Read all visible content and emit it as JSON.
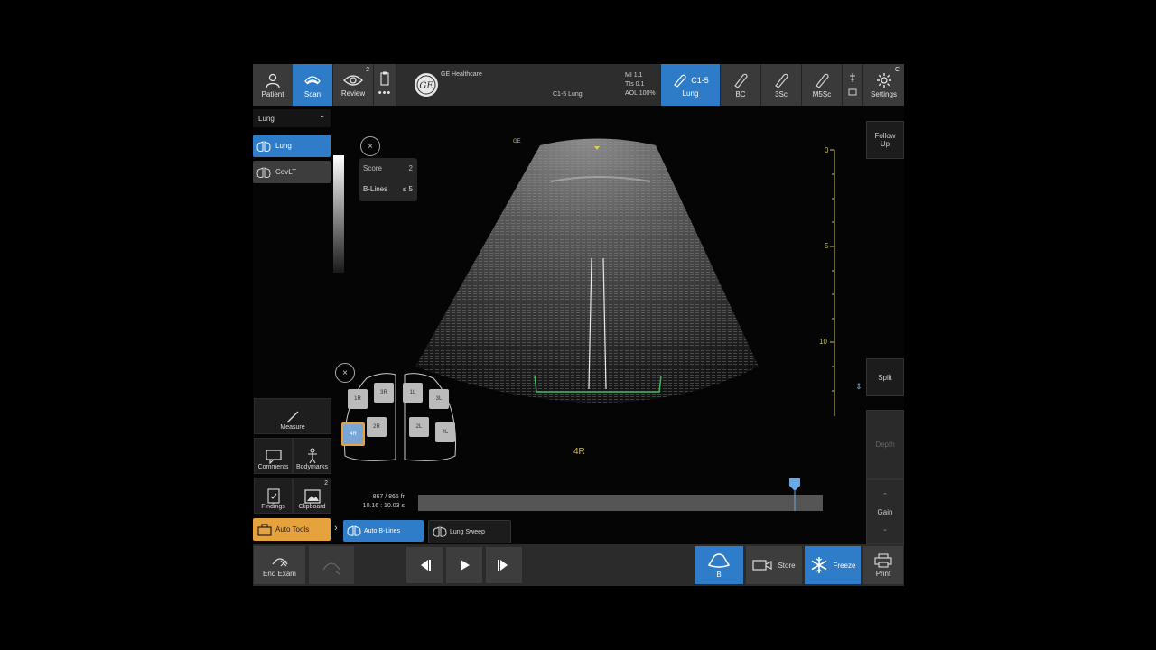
{
  "toolbar": {
    "patient": "Patient",
    "scan": "Scan",
    "review": "Review",
    "review_badge": "2",
    "more": "•••",
    "brand": "GE Healthcare",
    "probe_preset": "C1-5  Lung",
    "mi": "MI 1.1",
    "tis": "TIs 0.1",
    "aol": "AOL 100%",
    "probes": [
      {
        "title": "C1-5",
        "sub": "Lung"
      },
      {
        "title": "",
        "sub": "BC"
      },
      {
        "title": "",
        "sub": "3Sc"
      },
      {
        "title": "",
        "sub": "M5Sc"
      }
    ],
    "settings": "Settings",
    "settings_badge": "C"
  },
  "left": {
    "preset_header": "Lung",
    "presets": [
      "Lung",
      "CovLT"
    ],
    "measure": "Measure",
    "comments": "Comments",
    "bodymarks": "Bodymarks",
    "findings": "Findings",
    "clipboard": "Clipboard",
    "clipboard_badge": "2",
    "auto_tools": "Auto Tools"
  },
  "overlay": {
    "score_label": "Score",
    "score_value": "2",
    "blines_label": "B-Lines",
    "blines_value": "≤ 5",
    "zone_label": "4R",
    "focus_label": "GE",
    "lung_zones_left": [
      "1R",
      "3R",
      "2R",
      "4R"
    ],
    "lung_zones_right": [
      "1L",
      "3L",
      "2L",
      "4L"
    ]
  },
  "depth_scale": {
    "ticks": [
      "0",
      "5",
      "10"
    ]
  },
  "cine": {
    "frames": "867 / 865 fr",
    "time": "10.16 : 10.03 s",
    "position": 0.93
  },
  "auto_tabs": [
    "Auto B-Lines",
    "Lung Sweep"
  ],
  "right": {
    "follow_up": "Follow Up",
    "split": "Split",
    "depth": "Depth",
    "gain": "Gain"
  },
  "bottom": {
    "end_exam": "End Exam",
    "mode_b": "B",
    "store": "Store",
    "freeze": "Freeze",
    "print": "Print"
  },
  "colors": {
    "accent_blue": "#2f7cc9",
    "auto_tools_orange": "#e6a23c",
    "caliper_green": "#3cc060",
    "scale_yellow": "#c8c050"
  }
}
